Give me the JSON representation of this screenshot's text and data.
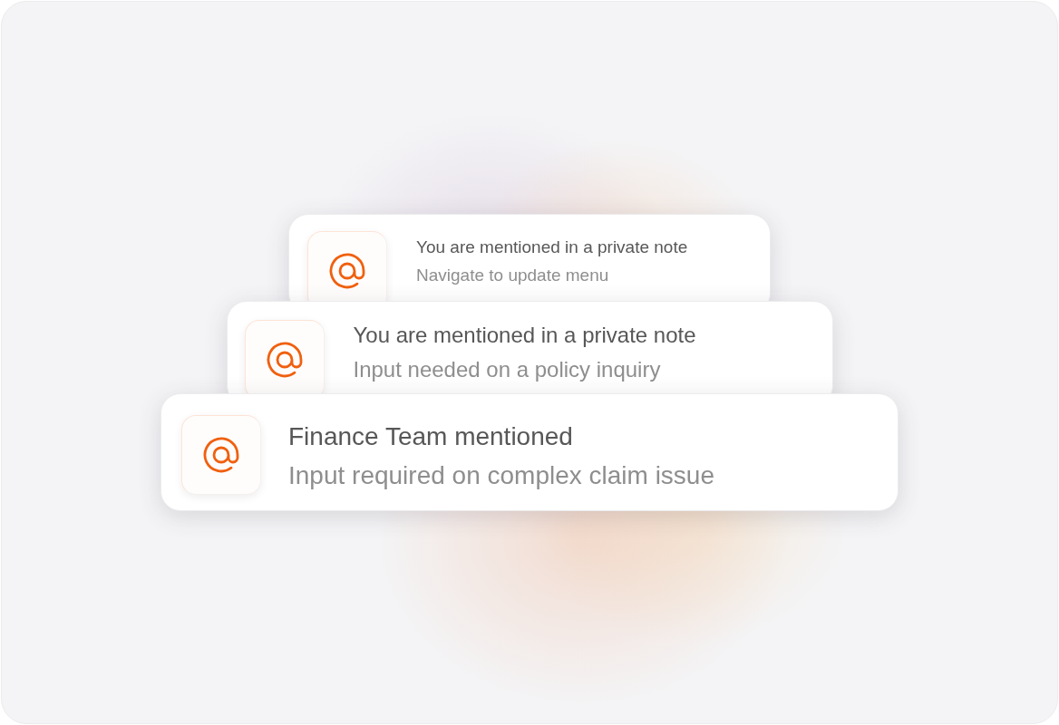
{
  "notifications": [
    {
      "title": "You are mentioned in a private note",
      "message": "Navigate to update menu"
    },
    {
      "title": "You are mentioned in a private note",
      "message": "Input needed on a policy inquiry"
    },
    {
      "title": "Finance Team mentioned",
      "message": "Input required on complex claim issue"
    }
  ]
}
